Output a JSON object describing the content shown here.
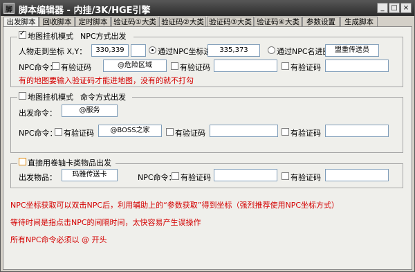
{
  "window": {
    "title": "脚本编辑器 - 内挂/3K/HGE引擎",
    "icon_glyph": "脚"
  },
  "controls": {
    "minimize": "_",
    "restore": "□",
    "close": "×"
  },
  "tabs": [
    "出发脚本",
    "回收脚本",
    "定时脚本",
    "验证码①大类",
    "验证码②大类",
    "验证码③大类",
    "验证码④大类",
    "参数设置",
    "生成脚本"
  ],
  "section1": {
    "map_mode_label": "地图挂机模式",
    "npc_mode_label": "NPC方式出发",
    "coord_label": "人物走到坐标 X,Y：",
    "coord_value": "330,339",
    "radio_coord_label": "通过NPC坐标进图：",
    "radio_coord_value": "335,373",
    "radio_name_label": "通过NPC名进图：",
    "radio_name_value": "盟重传送员",
    "npc_cmd_label": "NPC命令：",
    "verify_label": "有验证码",
    "cmd1_value": "@危险区域",
    "note": "有的地图要输入验证码才能进地图，没有的就不打勾"
  },
  "section2": {
    "map_mode_label": "地图挂机模式",
    "cmd_mode_label": "命令方式出发",
    "depart_cmd_label": "出发命令：",
    "depart_cmd_value": "@服务",
    "npc_cmd_label": "NPC命令：",
    "verify_label": "有验证码",
    "cmd1_value": "@BOSS之家"
  },
  "section3": {
    "scroll_label": "直接用卷轴卡类物品出发",
    "item_label": "出发物品：",
    "item_value": "玛雅传送卡",
    "npc_cmd_label": "NPC命令：",
    "verify_label": "有验证码"
  },
  "notes": [
    "NPC坐标获取可以双击NPC后，利用辅助上的“参数获取”得到坐标（强烈推荐使用NPC坐标方式）",
    "等待时间是指点击NPC的间隔时间，太快容易产生误操作",
    "所有NPC命令必须以 @ 开头"
  ],
  "colors": {
    "note_red": "#d40000",
    "titlebar": "#3a3a3a",
    "panel": "#efefeb",
    "scroll_checkbox": "#e08a10"
  }
}
